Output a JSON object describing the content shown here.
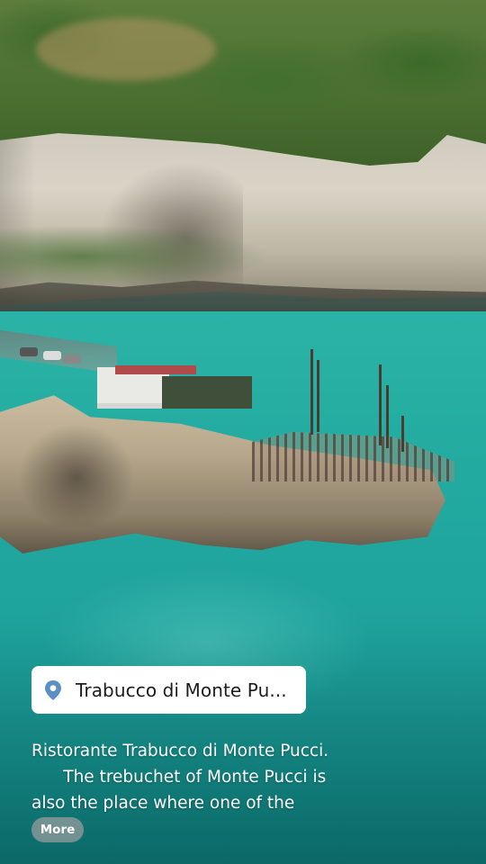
{
  "location": {
    "icon": "map-pin-icon",
    "icon_color": "#5b8ec2",
    "label": "Trabucco di Monte Pu..."
  },
  "caption": {
    "line1": "Ristorante Trabucco di Monte Pucci.",
    "line2": "      The trebuchet of Monte Pucci is",
    "line3": "also the place where one of the"
  },
  "more_button": {
    "label": "More"
  },
  "colors": {
    "sea": "#1fa39d",
    "pill_background": "#ffffff",
    "caption_text": "#ffffff"
  }
}
